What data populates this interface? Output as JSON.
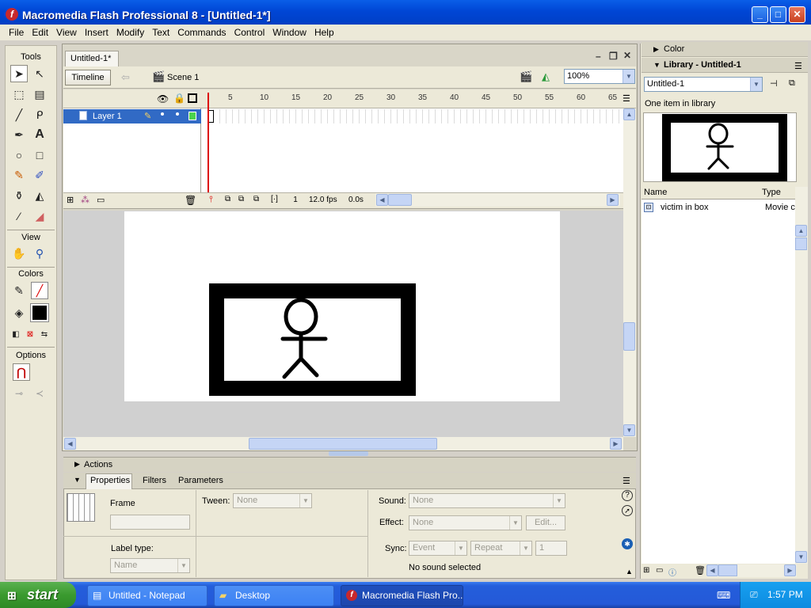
{
  "window": {
    "title": "Macromedia Flash Professional 8 - [Untitled-1*]"
  },
  "menu": [
    "File",
    "Edit",
    "View",
    "Insert",
    "Modify",
    "Text",
    "Commands",
    "Control",
    "Window",
    "Help"
  ],
  "tools": {
    "header": "Tools",
    "view_label": "View",
    "colors_label": "Colors",
    "options_label": "Options"
  },
  "document": {
    "tab_label": "Untitled-1*",
    "timeline_button": "Timeline",
    "scene_label": "Scene 1",
    "zoom": "100%"
  },
  "timeline": {
    "layer_name": "Layer 1",
    "frame_numbers": [
      "5",
      "10",
      "15",
      "20",
      "25",
      "30",
      "35",
      "40",
      "45",
      "50",
      "55",
      "60",
      "65"
    ],
    "current_frame": "1",
    "fps": "12.0 fps",
    "time": "0.0s"
  },
  "panels": {
    "actions": "Actions",
    "tabs": [
      "Properties",
      "Filters",
      "Parameters"
    ]
  },
  "properties": {
    "frame_label": "Frame",
    "label_type_label": "Label type:",
    "label_type_value": "Name",
    "tween_label": "Tween:",
    "tween_value": "None",
    "sound_label": "Sound:",
    "sound_value": "None",
    "effect_label": "Effect:",
    "effect_value": "None",
    "edit_button": "Edit...",
    "sync_label": "Sync:",
    "sync_value": "Event",
    "repeat_value": "Repeat",
    "repeat_count": "1",
    "no_sound": "No sound selected"
  },
  "library": {
    "color_header": "Color",
    "header": "Library - Untitled-1",
    "selected_doc": "Untitled-1",
    "item_count": "One item in library",
    "col_name": "Name",
    "col_type": "Type",
    "items": [
      {
        "name": "victim in box",
        "type": "Movie c"
      }
    ]
  },
  "taskbar": {
    "start": "start",
    "tasks": [
      "Untitled - Notepad",
      "Desktop",
      "Macromedia Flash Pro..."
    ],
    "clock": "1:57 PM"
  }
}
